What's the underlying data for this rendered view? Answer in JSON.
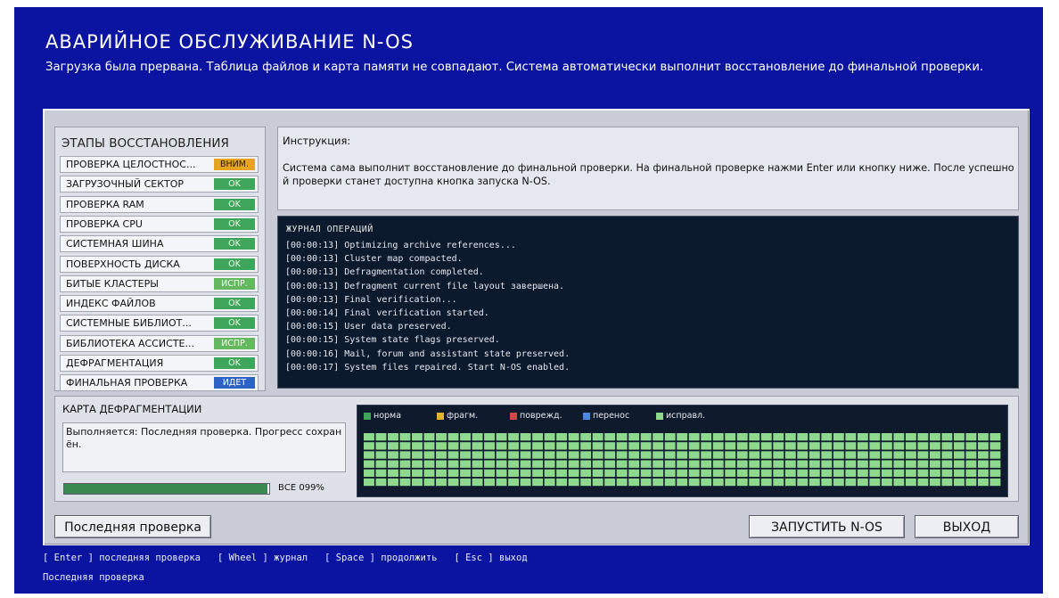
{
  "header": {
    "title": "АВАРИЙНОЕ ОБСЛУЖИВАНИЕ N-OS",
    "subtitle": "Загрузка была прервана. Таблица файлов и карта памяти не совпадают. Система автоматически выполнит восстановление до финальной проверки."
  },
  "stages": {
    "title": "ЭТАПЫ ВОССТАНОВЛЕНИЯ",
    "items": [
      {
        "label": "ПРОВЕРКА ЦЕЛОСТНОС...",
        "status": "ВНИМ.",
        "kind": "warn"
      },
      {
        "label": "ЗАГРУЗОЧНЫЙ СЕКТОР",
        "status": "OK",
        "kind": "ok"
      },
      {
        "label": "ПРОВЕРКА RAM",
        "status": "OK",
        "kind": "ok"
      },
      {
        "label": "ПРОВЕРКА CPU",
        "status": "OK",
        "kind": "ok"
      },
      {
        "label": "СИСТЕМНАЯ ШИНА",
        "status": "OK",
        "kind": "ok"
      },
      {
        "label": "ПОВЕРХНОСТЬ ДИСКА",
        "status": "OK",
        "kind": "ok"
      },
      {
        "label": "БИТЫЕ КЛАСТЕРЫ",
        "status": "ИСПР.",
        "kind": "fix"
      },
      {
        "label": "ИНДЕКС ФАЙЛОВ",
        "status": "OK",
        "kind": "ok"
      },
      {
        "label": "СИСТЕМНЫЕ БИБЛИОТ...",
        "status": "OK",
        "kind": "ok"
      },
      {
        "label": "БИБЛИОТЕКА АССИСТЕ...",
        "status": "ИСПР.",
        "kind": "fix"
      },
      {
        "label": "ДЕФРАГМЕНТАЦИЯ",
        "status": "OK",
        "kind": "ok"
      },
      {
        "label": "ФИНАЛЬНАЯ ПРОВЕРКА",
        "status": "ИДЕТ",
        "kind": "run"
      }
    ]
  },
  "instruction": {
    "title": "Инструкция:",
    "text": "Система сама выполнит восстановление до финальной проверки. На финальной проверке нажми Enter или кнопку ниже. После успешной проверки станет доступна кнопка запуска N-OS."
  },
  "log": {
    "title": "ЖУРНАЛ ОПЕРАЦИЙ",
    "lines": [
      "[00:00:13] Optimizing archive references...",
      "[00:00:13] Cluster map compacted.",
      "[00:00:13] Defragmentation completed.",
      "[00:00:13] Defragment current file layout завершена.",
      "[00:00:13] Final verification...",
      "[00:00:14] Final verification started.",
      "[00:00:15] User data preserved.",
      "[00:00:15] System state flags preserved.",
      "[00:00:16] Mail, forum and assistant state preserved.",
      "[00:00:17] System files repaired. Start N-OS enabled."
    ]
  },
  "defrag": {
    "title": "КАРТА ДЕФРАГМЕНТАЦИИ",
    "status": "Выполняется: Последняя проверка. Прогресс сохранён.",
    "progress_label": "ВСЕ 099%",
    "progress_fraction": 0.99,
    "legend": [
      {
        "label": "норма",
        "color": "#3fa55a"
      },
      {
        "label": "фрагм.",
        "color": "#e6b030"
      },
      {
        "label": "поврежд.",
        "color": "#d04848"
      },
      {
        "label": "перенос",
        "color": "#4a8ad8"
      },
      {
        "label": "исправл.",
        "color": "#8ed98e"
      }
    ],
    "block_color": "#8ed98e",
    "block_rows": 6,
    "block_cols": 53
  },
  "buttons": {
    "last_check": "Последняя проверка",
    "start": "ЗАПУСТИТЬ N-OS",
    "exit": "ВЫХОД"
  },
  "hints": {
    "keys": "[ Enter ] последняя проверка   [ Wheel ] журнал   [ Space ] продолжить   [ Esc ] выход",
    "status": "Последняя проверка"
  },
  "colors": {
    "background": "#0a14a0",
    "panel": "#c9ccd6",
    "log_bg": "#0c1a2e"
  }
}
